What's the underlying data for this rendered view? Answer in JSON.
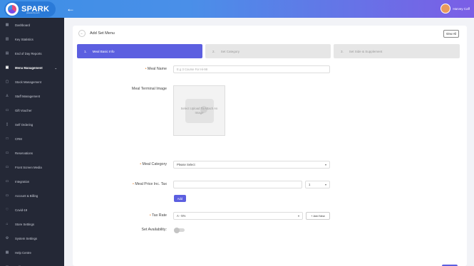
{
  "app": {
    "logo_text": "SPARK",
    "logo_sub": "powered by tech",
    "user_name": "Harvey Caff"
  },
  "sidebar": {
    "items": [
      {
        "label": "Dashboard",
        "icon": "dashboard-icon",
        "glyph": "▦"
      },
      {
        "label": "Key Statistics",
        "icon": "chart-icon",
        "glyph": "▥"
      },
      {
        "label": "End of Day Reports",
        "icon": "report-icon",
        "glyph": "▤"
      },
      {
        "label": "Menu Management",
        "icon": "menu-icon",
        "glyph": "▣",
        "active": true
      },
      {
        "label": "Stock Management",
        "icon": "stock-icon",
        "glyph": "▢"
      },
      {
        "label": "Staff Management",
        "icon": "staff-icon",
        "glyph": "♙"
      },
      {
        "label": "Gift Voucher",
        "icon": "gift-icon",
        "glyph": "▭"
      },
      {
        "label": "Self Ordering",
        "icon": "ordering-icon",
        "glyph": "▯"
      },
      {
        "label": "CRM",
        "icon": "crm-icon",
        "glyph": "□"
      },
      {
        "label": "Reservations",
        "icon": "calendar-icon",
        "glyph": "▭"
      },
      {
        "label": "Front Screen Media",
        "icon": "media-icon",
        "glyph": "▭"
      },
      {
        "label": "Integration",
        "icon": "integration-icon",
        "glyph": "▭"
      },
      {
        "label": "Account & Billing",
        "icon": "billing-icon",
        "glyph": "▭"
      },
      {
        "label": "Covid-19",
        "icon": "covid-icon",
        "glyph": "♡"
      },
      {
        "label": "Store Settings",
        "icon": "store-icon",
        "glyph": "⌂"
      },
      {
        "label": "System Settings",
        "icon": "settings-icon",
        "glyph": "⚙"
      },
      {
        "label": "Help Centre",
        "icon": "help-icon",
        "glyph": "▦"
      },
      {
        "label": "Self Management",
        "icon": "self-icon",
        "glyph": "▭"
      }
    ]
  },
  "page": {
    "title": "Add Set Menu",
    "view_all": "View All"
  },
  "steps": [
    {
      "num": "1.",
      "label": "Meal Basic Info"
    },
    {
      "num": "2.",
      "label": "Set Category"
    },
    {
      "num": "3.",
      "label": "Set Side & Supplement"
    }
  ],
  "form": {
    "meal_name_label": "Meal Name",
    "meal_name_placeholder": "E.g 3 Course For Hi-99",
    "terminal_image_label": "Meal Terminal Image",
    "upload_text": "Select Upload To Attach An Image",
    "meal_category_label": "Meal Category",
    "meal_category_value": "Please Select",
    "meal_price_label": "Meal Price Inc. Tax",
    "meal_price_value": "",
    "price_qty_value": "1",
    "add_button": "Add",
    "tax_rate_label": "Tax Rate",
    "tax_rate_value": "A - 5%",
    "add_new_button": "+ Add New",
    "set_availability_label": "Set Availability:",
    "set_availability_on": false
  },
  "colors": {
    "primary": "#5c5fe0",
    "sidebar_bg": "#242836",
    "required_marker": "#e88a3a"
  }
}
